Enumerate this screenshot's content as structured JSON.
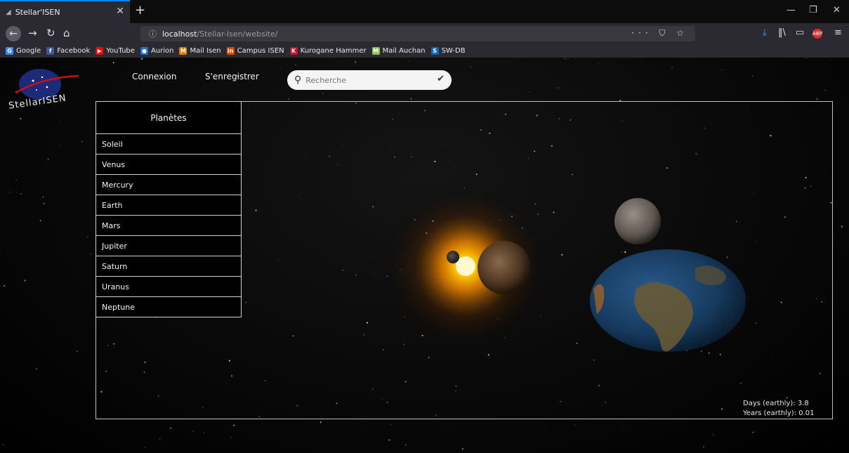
{
  "browser": {
    "tab_title": "Stellar'ISEN",
    "new_tab": "+",
    "url_host": "localhost",
    "url_path": "/Stellar-Isen/website/",
    "url_actions": "··· ⛉ ☆",
    "bookmarks": [
      {
        "label": "Google",
        "color": "#4285f4",
        "glyph": "G"
      },
      {
        "label": "Facebook",
        "color": "#3b5998",
        "glyph": "f"
      },
      {
        "label": "YouTube",
        "color": "#ff0000",
        "glyph": "▶"
      },
      {
        "label": "Aurion",
        "color": "#1d6fd6",
        "glyph": "●"
      },
      {
        "label": "Mail Isen",
        "color": "#e07b00",
        "glyph": "M"
      },
      {
        "label": "Campus ISEN",
        "color": "#e04a00",
        "glyph": "in"
      },
      {
        "label": "Kurogane Hammer",
        "color": "#c8102e",
        "glyph": "K"
      },
      {
        "label": "Mail Auchan",
        "color": "#8bc34a",
        "glyph": "M"
      },
      {
        "label": "SW-DB",
        "color": "#1565c0",
        "glyph": "S"
      }
    ]
  },
  "site": {
    "logo_text": "StellarISEN",
    "nav": {
      "login": "Connexion",
      "register": "S'enregistrer"
    },
    "search": {
      "placeholder": "Recherche"
    },
    "menu": {
      "heading": "Planètes",
      "items": [
        "Soleil",
        "Venus",
        "Mercury",
        "Earth",
        "Mars",
        "Jupiter",
        "Saturn",
        "Uranus",
        "Neptune"
      ]
    },
    "stats": {
      "days": "Days (earthly): 3.8",
      "years": "Years (earthly): 0.01"
    }
  }
}
